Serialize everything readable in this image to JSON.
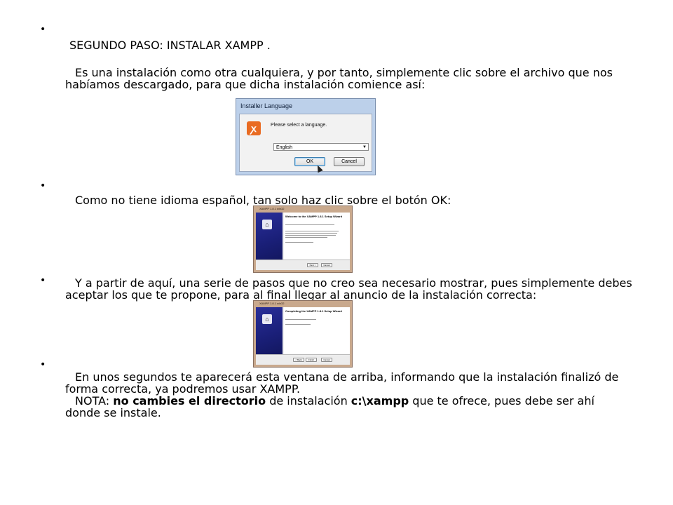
{
  "items": [
    {
      "title": "SEGUNDO PASO: INSTALAR XAMPP .",
      "body": "Es una instalación como otra cualquiera, y por tanto, simplemente clic sobre el archivo que nos habíamos descargado, para que dicha instalación comience así:"
    },
    {
      "body": "Como no tiene idioma español, tan solo haz clic sobre el botón OK:"
    },
    {
      "body": "Y a partir de aquí, una serie de pasos que no creo sea necesario mostrar, pues simplemente debes aceptar los que te propone, para al final llegar al anuncio de la instalación correcta:"
    },
    {
      "body": "En unos segundos te aparecerá esta ventana de arriba, informando que la instalación finalizó de forma correcta, ya podremos usar XAMPP.",
      "note_prefix": "NOTA: ",
      "note_bold1": "no cambies el directorio",
      "note_mid": " de instalación ",
      "note_bold2": "c:\\xampp",
      "note_end": " que te ofrece, pues debe ser ahí donde se instale."
    }
  ],
  "dialog_language": {
    "title": "Installer Language",
    "message": "Please select a language.",
    "selected_language": "English",
    "ok_label": "OK",
    "cancel_label": "Cancel",
    "logo_icon": "xampp-logo-icon",
    "accent": "#e96b22"
  },
  "dialog_welcome": {
    "title": "XAMPP 1.8.1 win32",
    "heading": "Welcome to the XAMPP 1.8.1 Setup Wizard",
    "next_label": "Next >",
    "cancel_label": "Cancel"
  },
  "dialog_complete": {
    "title": "XAMPP 1.8.1 win32",
    "heading": "Completing the XAMPP 1.8.1 Setup Wizard",
    "back_label": "< Back",
    "finish_label": "Finish",
    "cancel_label": "Cancel"
  }
}
